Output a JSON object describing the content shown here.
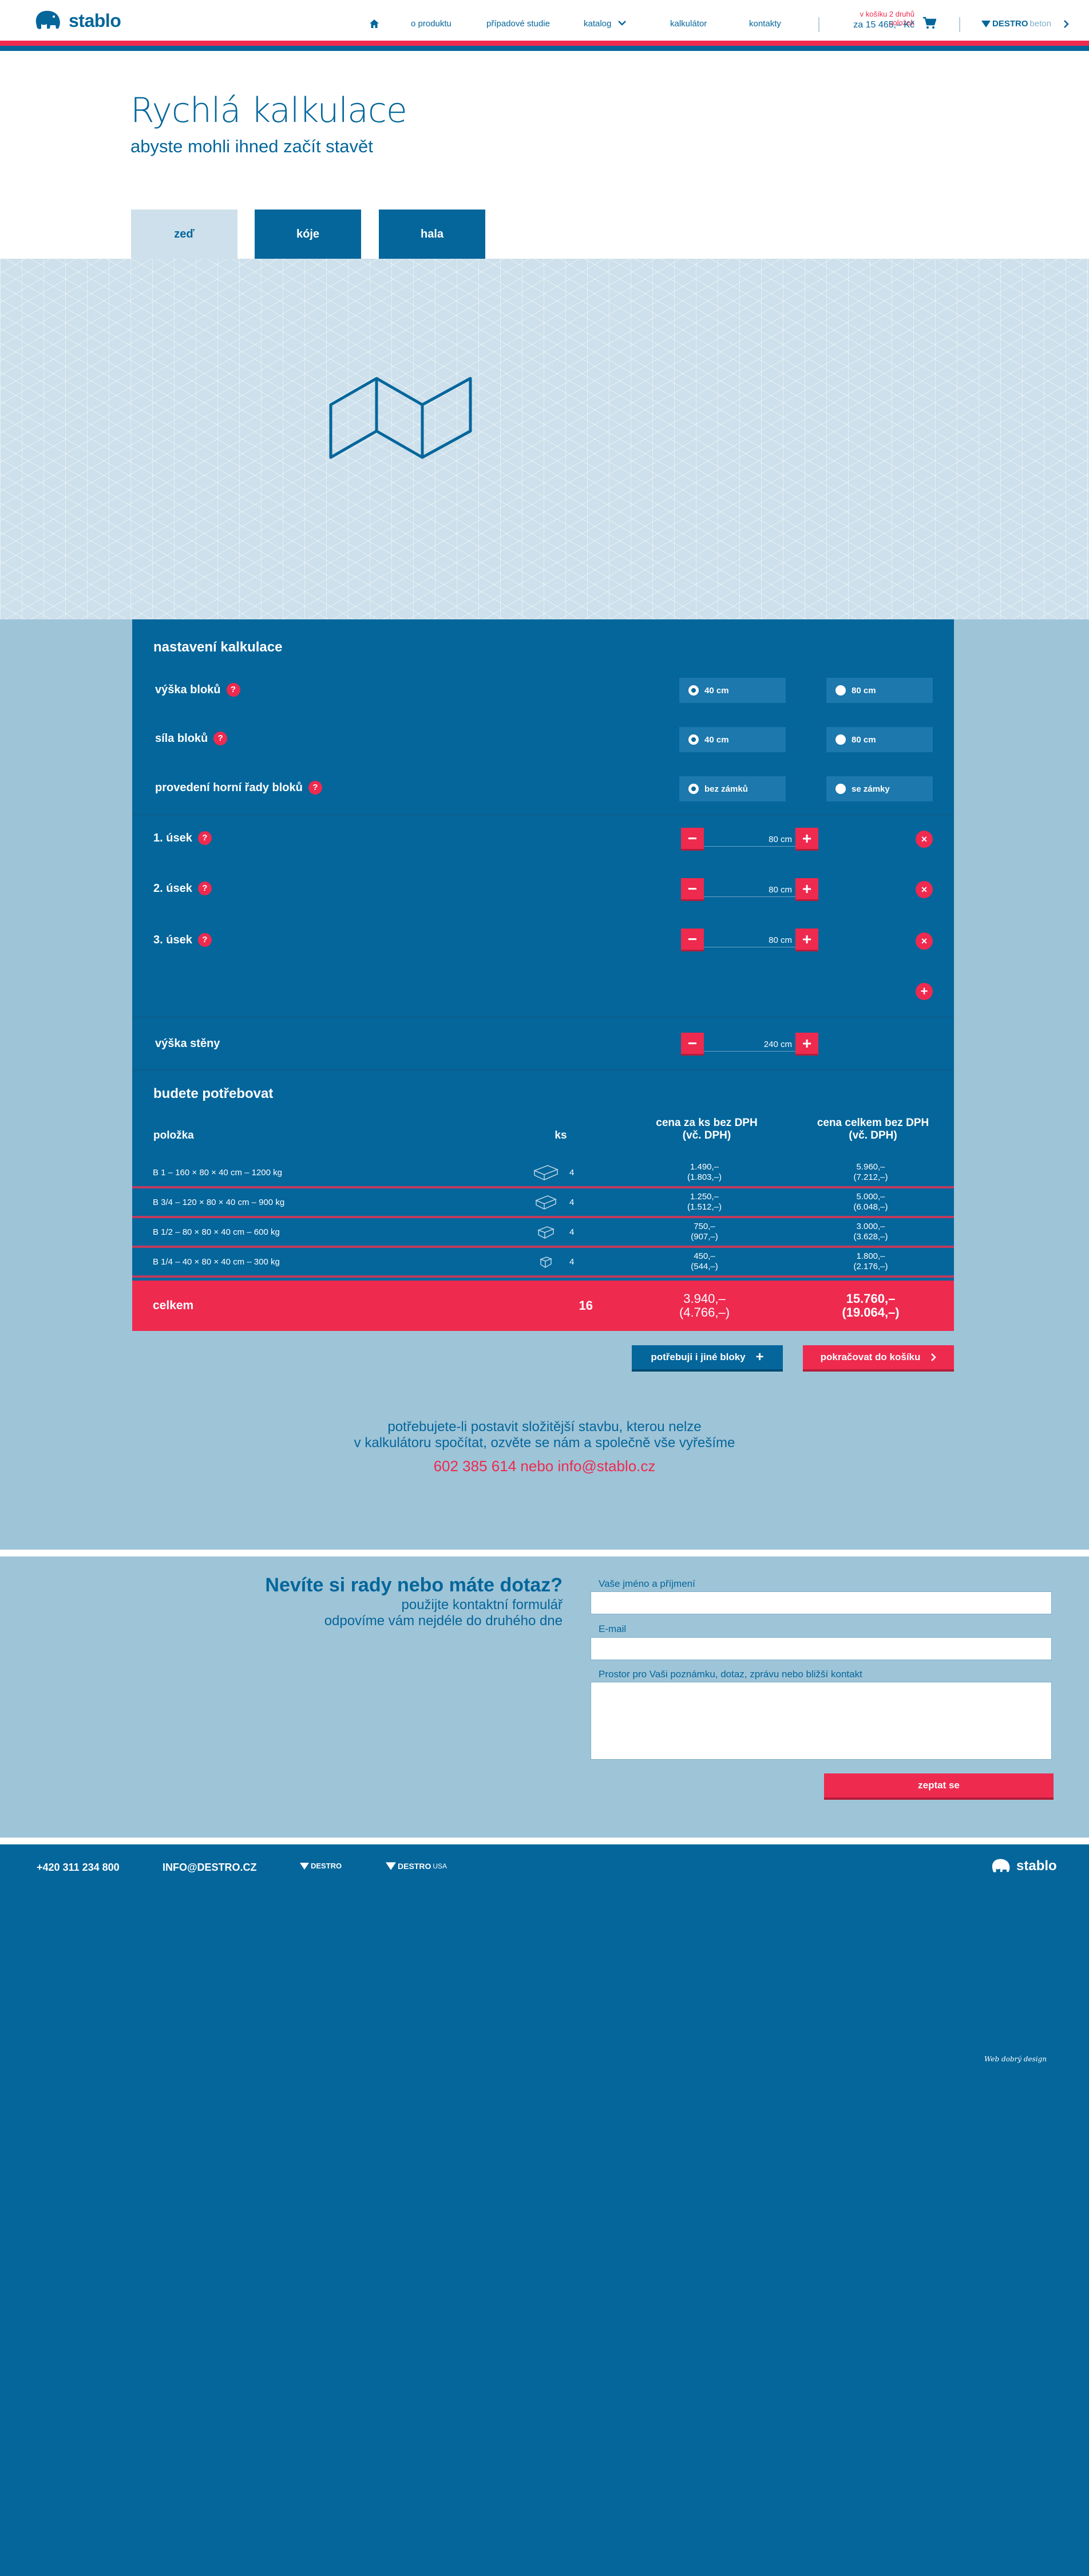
{
  "header": {
    "logo": "stablo",
    "nav": [
      "o produktu",
      "případové studie",
      "katalog",
      "kalkulátor",
      "kontakty"
    ],
    "cart_info": "v košíku 2 druhů položek",
    "cart_total": "za 15 465,– Kč",
    "brand": "DESTRO",
    "brand_suffix": "beton"
  },
  "hero": {
    "title": "Rychlá kalkulace",
    "subtitle": "abyste mohli ihned začít stavět",
    "tabs": [
      "zeď",
      "kóje",
      "hala"
    ]
  },
  "settings": {
    "title": "nastavení kalkulace",
    "rows": [
      {
        "label": "výška bloků",
        "options": [
          "40 cm",
          "80 cm"
        ]
      },
      {
        "label": "síla bloků",
        "options": [
          "40 cm",
          "80 cm"
        ]
      },
      {
        "label": "provedení horní řady bloků",
        "options": [
          "bez zámků",
          "se zámky"
        ]
      }
    ],
    "segments": [
      {
        "label": "1. úsek",
        "value": "80 cm"
      },
      {
        "label": "2. úsek",
        "value": "80 cm"
      },
      {
        "label": "3. úsek",
        "value": "80 cm"
      }
    ],
    "wall_height": {
      "label": "výška stěny",
      "value": "240 cm"
    },
    "help_glyph": "?",
    "minus_glyph": "−",
    "plus_glyph": "+",
    "remove_glyph": "×"
  },
  "needs": {
    "title": "budete potřebovat",
    "col_item": "položka",
    "col_qty": "ks",
    "col_unit": [
      "cena za ks bez DPH",
      "(vč. DPH)"
    ],
    "col_total": [
      "cena celkem bez DPH",
      "(vč. DPH)"
    ],
    "items": [
      {
        "name": "B 1 – 160 × 80 × 40 cm – 1200 kg",
        "qty": "4",
        "unit": "1.490,–",
        "unit_vat": "(1.803,–)",
        "total": "5.960,–",
        "total_vat": "(7.212,–)"
      },
      {
        "name": "B 3/4 – 120 × 80 × 40 cm – 900 kg",
        "qty": "4",
        "unit": "1.250,–",
        "unit_vat": "(1.512,–)",
        "total": "5.000,–",
        "total_vat": "(6.048,–)"
      },
      {
        "name": "B 1/2 – 80 × 80 × 40 cm – 600 kg",
        "qty": "4",
        "unit": "750,–",
        "unit_vat": "(907,–)",
        "total": "3.000,–",
        "total_vat": "(3.628,–)"
      },
      {
        "name": "B 1/4 – 40 × 80 × 40 cm – 300 kg",
        "qty": "4",
        "unit": "450,–",
        "unit_vat": "(544,–)",
        "total": "1.800,–",
        "total_vat": "(2.176,–)"
      }
    ],
    "total": {
      "label": "celkem",
      "qty": "16",
      "unit": "3.940,–",
      "unit_vat": "(4.766,–)",
      "total": "15.760,–",
      "total_vat": "(19.064,–)"
    }
  },
  "actions": {
    "other_blocks": "potřebuji i jiné bloky",
    "continue": "pokračovat do košíku"
  },
  "note": {
    "line1": "potřebujete-li postavit složitější stavbu, kterou nelze",
    "line2": "v kalkulátoru spočítat, ozvěte se nám a společně vše vyřešíme",
    "phone": "602 385 614",
    "or": "nebo",
    "email": "info@stablo.cz"
  },
  "contact_form": {
    "title": "Nevíte si rady nebo máte dotaz?",
    "sub1": "použijte kontaktní formulář",
    "sub2": "odpovíme vám nejdéle do druhého dne",
    "name_label": "Vaše jméno a příjmení",
    "email_label": "E-mail",
    "message_label": "Prostor pro Vaši poznámku, dotaz, zprávu nebo bližší kontakt",
    "submit": "zeptat se"
  },
  "footer": {
    "phone": "+420 311 234 800",
    "email": "INFO@DESTRO.CZ",
    "brand1": "DESTRO",
    "brand2": "DESTRO",
    "brand2_suffix": "USA",
    "logo": "stablo",
    "credit": "Web dobrý design"
  },
  "colors": {
    "primary": "#04669b",
    "accent": "#ee2a4f",
    "light": "#9ec4d7",
    "pale": "#cde0eb"
  }
}
